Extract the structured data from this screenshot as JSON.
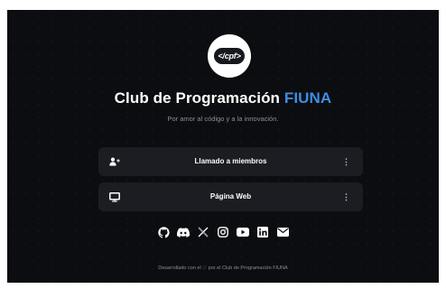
{
  "header": {
    "logo_text": "</cpf>",
    "title_main": "Club de Programación",
    "title_accent": "FIUNA",
    "subtitle": "Por amor al código y a la innovación."
  },
  "links": [
    {
      "label": "Llamado a miembros",
      "icon": "add-user-icon",
      "more": "⋮"
    },
    {
      "label": "Página Web",
      "icon": "monitor-icon",
      "more": "⋮"
    }
  ],
  "social": [
    "github-icon",
    "discord-icon",
    "x-icon",
    "instagram-icon",
    "youtube-icon",
    "linkedin-icon",
    "mail-icon"
  ],
  "footer": {
    "text": "Desarrollado con el ♡ por el Club de Programación FIUNA"
  },
  "colors": {
    "accent": "#3b8fe4",
    "background": "#0c0d10",
    "card": "#1b1d22"
  }
}
